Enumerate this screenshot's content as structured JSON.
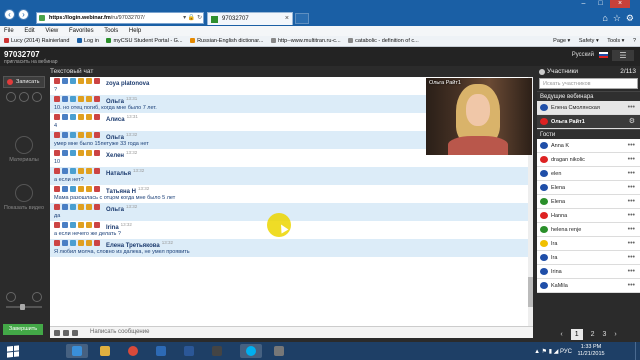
{
  "browser": {
    "url_host": "https://login.webinar.fm",
    "url_path": "/ru/97032707/",
    "url_tools": "▾ 🔒 ↻",
    "tab_title": "97032707",
    "menu": [
      "File",
      "Edit",
      "View",
      "Favorites",
      "Tools",
      "Help"
    ],
    "favorites": [
      "Lucy (2014) Rainierland",
      "Log in",
      "myCSU Student Portal - G...",
      "Russian-English dictionar...",
      "http--www.multitran.ru-c...",
      "catabolic - definition of c..."
    ],
    "commands": [
      "Page ▾",
      "Safety ▾",
      "Tools ▾",
      "?"
    ]
  },
  "app": {
    "room_id": "97032707",
    "room_subtitle": "пригласить на вебинар",
    "language": "Русский",
    "menu_icon": "☰",
    "record_label": "Записать",
    "materials_label": "Материалы",
    "show_video_label": "Показать видео",
    "finish_label": "Завершить"
  },
  "chat": {
    "title": "Текстовый чат",
    "input_placeholder": "Написать сообщение",
    "messages": [
      {
        "name": "zoya platonova",
        "time": "",
        "text": "?",
        "alt": false
      },
      {
        "name": "Ольга",
        "time": "13:31",
        "text": "10. но отец погиб, когда мне было 7 лет.",
        "alt": true
      },
      {
        "name": "Алиса",
        "time": "13:31",
        "text": "4",
        "alt": false
      },
      {
        "name": "Ольга",
        "time": "13:32",
        "text": "умер мне было 15петуже 33 года нет",
        "alt": true
      },
      {
        "name": "Хелен",
        "time": "13:32",
        "text": "10",
        "alt": false
      },
      {
        "name": "Наталья",
        "time": "13:32",
        "text": "а если нет?",
        "alt": true
      },
      {
        "name": "Татьяна Н",
        "time": "13:32",
        "text": "Мама разошлась с отцом когда мне было 5 лет",
        "alt": false
      },
      {
        "name": "Ольга",
        "time": "13:32",
        "text": "да",
        "alt": true
      },
      {
        "name": "Irina",
        "time": "13:32",
        "text": "а если нечего же делать ?",
        "alt": false
      },
      {
        "name": "Елена Третьякова",
        "time": "13:32",
        "text": "Я любил молча, словно из далека, не умел проявить",
        "alt": true
      }
    ]
  },
  "video": {
    "label": "Ольга Райт1"
  },
  "participants": {
    "title": "Участники",
    "count": "2/113",
    "search_placeholder": "Искать участников",
    "hosts_label": "Ведущие вебинара",
    "guests_label": "Гости",
    "hosts": [
      {
        "name": "Елена Смолянская",
        "flag": "#1f4ea8",
        "style": "host"
      },
      {
        "name": "Ольга Райт1",
        "flag": "#d22",
        "style": "me"
      }
    ],
    "guests": [
      {
        "name": "Anna K",
        "flag": "#1f4ea8"
      },
      {
        "name": "dragan nikolic",
        "flag": "#d22"
      },
      {
        "name": "elen",
        "flag": "#1f4ea8"
      },
      {
        "name": "Elena",
        "flag": "#1f4ea8"
      },
      {
        "name": "Elena",
        "flag": "#2a8f2a"
      },
      {
        "name": "Hanna",
        "flag": "#d22"
      },
      {
        "name": "helena renje",
        "flag": "#2a8f2a"
      },
      {
        "name": "Ira",
        "flag": "#f0c000"
      },
      {
        "name": "Ira",
        "flag": "#1f4ea8"
      },
      {
        "name": "Irina",
        "flag": "#1f4ea8"
      },
      {
        "name": "KaMila",
        "flag": "#1f4ea8"
      }
    ],
    "pages": {
      "prev": "‹",
      "current": "1",
      "next_pages": [
        "2",
        "3"
      ],
      "next": "›"
    }
  },
  "taskbar": {
    "time": "1:33 PM",
    "date": "11/21/2015",
    "lang": "РУС"
  }
}
